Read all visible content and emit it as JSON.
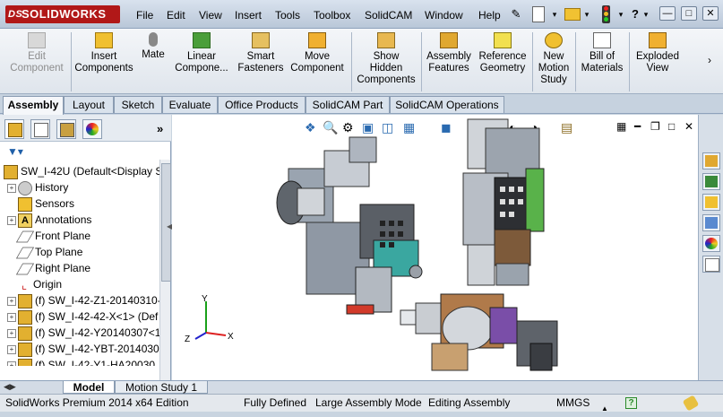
{
  "app": {
    "logo_text": "SOLIDWORKS",
    "logo_mark": "DS"
  },
  "menu": [
    "File",
    "Edit",
    "View",
    "Insert",
    "Tools",
    "Toolbox",
    "SolidCAM",
    "Window",
    "Help"
  ],
  "command_manager": {
    "edit_component": "Edit\nComponent",
    "insert_components": "Insert\nComponents",
    "mate": "Mate",
    "linear_component": "Linear\nCompone...",
    "smart_fasteners": "Smart\nFasteners",
    "move_component": "Move\nComponent",
    "show_hidden": "Show\nHidden\nComponents",
    "assembly_features": "Assembly\nFeatures",
    "reference_geometry": "Reference\nGeometry",
    "new_motion_study": "New\nMotion\nStudy",
    "bill_of_materials": "Bill of\nMaterials",
    "exploded_view": "Exploded\nView"
  },
  "tabs": [
    "Assembly",
    "Layout",
    "Sketch",
    "Evaluate",
    "Office Products",
    "SolidCAM Part",
    "SolidCAM Operations"
  ],
  "tree": {
    "root": "SW_I-42U  (Default<Display S",
    "items": [
      "History",
      "Sensors",
      "Annotations",
      "Front Plane",
      "Top Plane",
      "Right Plane",
      "Origin",
      "(f) SW_I-42-Z1-20140310-",
      "(f) SW_I-42-42-X<1> (Def",
      "(f) SW_I-42-Y20140307<1",
      "(f) SW_I-42-YBT-2014030",
      "(f) SW_I-42-Y1-HA20030"
    ]
  },
  "bottom_tabs": [
    "Model",
    "Motion Study 1"
  ],
  "status": {
    "edition": "SolidWorks Premium 2014 x64 Edition",
    "defined": "Fully Defined",
    "mode": "Large Assembly Mode",
    "editing": "Editing Assembly",
    "units": "MMGS",
    "help": "?"
  },
  "triad": {
    "x": "X",
    "y": "Y",
    "z": "Z"
  },
  "colors": {
    "brand": "#b11818",
    "accent": "#1f5fa8"
  }
}
